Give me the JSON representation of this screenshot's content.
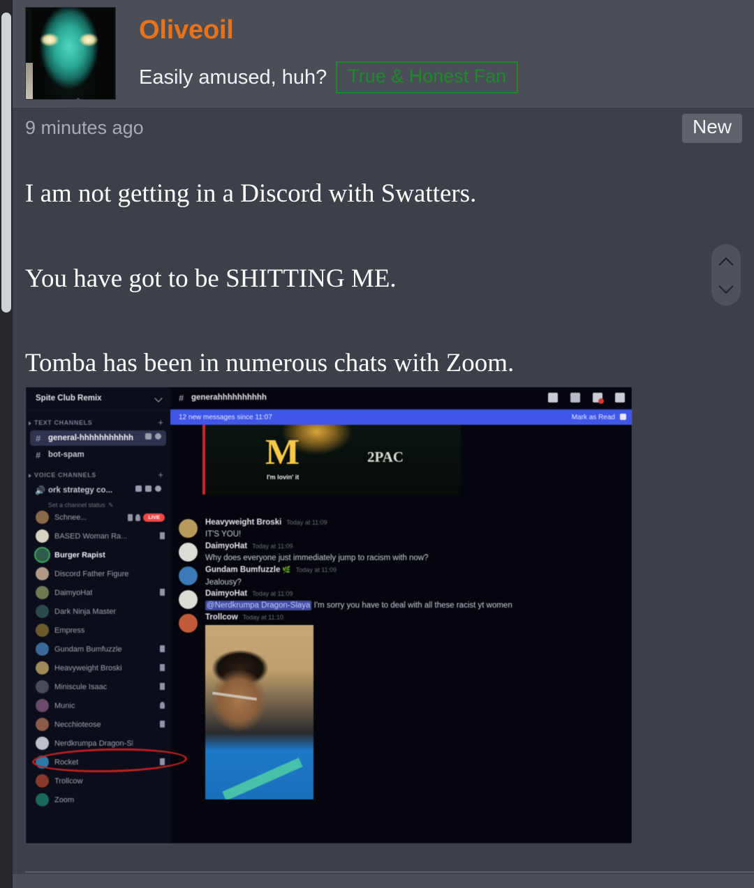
{
  "post": {
    "username": "Oliveoil",
    "tagline": "Easily amused, huh?",
    "fan_badge": "True & Honest Fan",
    "timestamp": "9 minutes ago",
    "new_badge": "New",
    "paragraphs": [
      "I am not getting in a Discord with Swatters.",
      "You have got to be SHITTING ME.",
      "Tomba has been in numerous chats with Zoom."
    ],
    "username_color": "#e8721a",
    "badge_color": "#1d8a2b"
  },
  "discord": {
    "server_name": "Spite Club Remix",
    "text_channels_label": "TEXT CHANNELS",
    "voice_channels_label": "VOICE CHANNELS",
    "add_label": "+",
    "text_channels": [
      {
        "name": "general-hhhhhhhhhhh",
        "active": true
      },
      {
        "name": "bot-spam",
        "active": false
      }
    ],
    "voice_channel": {
      "name": "ork strategy co...",
      "status": "Set a channel status"
    },
    "voice_members": [
      {
        "name": "Schnee...",
        "muted": true,
        "deafened": true,
        "live": "LIVE",
        "speaking": false
      },
      {
        "name": "BASED Woman Ra...",
        "muted": true,
        "speaking": false
      },
      {
        "name": "Burger Rapist",
        "muted": false,
        "speaking": true
      },
      {
        "name": "Discord Father Figure",
        "muted": false,
        "speaking": false
      },
      {
        "name": "DaimyoHat",
        "muted": true,
        "speaking": false
      },
      {
        "name": "Dark Ninja Master",
        "muted": false,
        "speaking": false
      },
      {
        "name": "Empress",
        "muted": false,
        "speaking": false
      },
      {
        "name": "Gundam Bumfuzzle",
        "muted": true,
        "speaking": false
      },
      {
        "name": "Heavyweight Broski",
        "muted": true,
        "speaking": false
      },
      {
        "name": "Miniscule Isaac",
        "muted": true,
        "speaking": false
      },
      {
        "name": "Munic",
        "deafened": true,
        "speaking": false
      },
      {
        "name": "Necchioteose",
        "muted": true,
        "speaking": false,
        "highlighted": true
      },
      {
        "name": "Nerdkrumpa Dragon-Sl...",
        "muted": false,
        "speaking": false
      },
      {
        "name": "Rocket",
        "muted": true,
        "speaking": false
      },
      {
        "name": "Trollcow",
        "muted": false,
        "speaking": false
      },
      {
        "name": "Zoom",
        "muted": false,
        "speaking": false
      }
    ],
    "chat_header": {
      "channel": "generahhhhhhhhhh",
      "hash": "#"
    },
    "new_messages_bar": {
      "text": "12 new messages since 11:07",
      "mark_as_read": "Mark as Read"
    },
    "embed_image": {
      "brand": "M",
      "slogan": "I'm lovin' it",
      "artist": "2PAC"
    },
    "messages": [
      {
        "author": "Heavyweight Broski",
        "stamp": "Today at 11:09",
        "content": "IT'S YOU!"
      },
      {
        "author": "DaimyoHat",
        "stamp": "Today at 11:09",
        "content": "Why does everyone just immediately jump to racism with now?"
      },
      {
        "author": "Gundam Bumfuzzle",
        "emoji": "🌿",
        "stamp": "Today at 11:09",
        "content": "Jealousy?"
      },
      {
        "author": "DaimyoHat",
        "stamp": "Today at 11:09",
        "mention": "@Nerdkrumpa Dragon-Slaya",
        "content": "I'm sorry you have to deal with all these racist yt women"
      },
      {
        "author": "Trollcow",
        "stamp": "Today at 11:10",
        "content": "",
        "attachment": true
      }
    ]
  }
}
